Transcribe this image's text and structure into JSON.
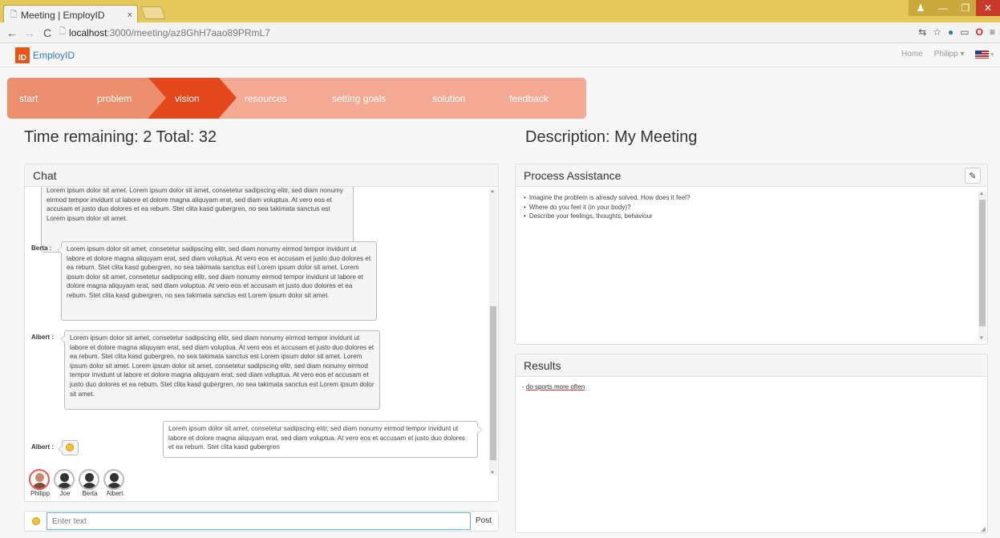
{
  "browser": {
    "tab_title": "Meeting | EmployID",
    "tab_close": "×",
    "url_host": "localhost",
    "url_path": ":3000/meeting/az8GhH7aao89PRmL7"
  },
  "app": {
    "logo_text": "ID",
    "brand": "EmployID",
    "nav_home": "Home",
    "nav_user": "Philipp ▾"
  },
  "steps": [
    {
      "label": "start",
      "state": "done"
    },
    {
      "label": "problem",
      "state": "done"
    },
    {
      "label": "vision",
      "state": "active"
    },
    {
      "label": "resources",
      "state": "todo"
    },
    {
      "label": "setting goals",
      "state": "todo"
    },
    {
      "label": "solution",
      "state": "todo"
    },
    {
      "label": "feedback",
      "state": "todo"
    }
  ],
  "colors": {
    "step_done": "#ec8f6f",
    "step_active": "#e4471c",
    "step_todo": "#f3a993",
    "steps_track": "#dba08d"
  },
  "meeting": {
    "timer": "Time remaining: 2 Total: 32",
    "description": "Description: My Meeting"
  },
  "chat": {
    "title": "Chat",
    "messages": [
      {
        "sender": "",
        "text": "Lorem ipsum dolor sit amet. Lorem ipsum dolor sit amet, consetetur sadipscing elitr, sed diam nonumy eirmod tempor invidunt ut labore et dolore magna aliquyam erat, sed diam voluptua. At vero eos et accusam et justo duo dolores et ea rebum. Stet clita kasd gubergren, no sea takimata sanctus est Lorem ipsum dolor sit amet."
      },
      {
        "sender": "Berta :",
        "text": "Lorem ipsum dolor sit amet, consetetur sadipscing elitr, sed diam nonumy eirmod tempor invidunt ut labore et dolore magna aliquyam erat, sed diam voluptua. At vero eos et accusam et justo duo dolores et ea rebum. Stet clita kasd gubergren, no sea takimata sanctus est Lorem ipsum dolor sit amet. Lorem ipsum dolor sit amet, consetetur sadipscing elitr, sed diam nonumy eirmod tempor invidunt ut labore et dolore magna aliquyam erat, sed diam voluptua. At vero eos et accusam et justo duo dolores et ea rebum. Stet clita kasd gubergren, no sea takimata sanctus est Lorem ipsum dolor sit amet."
      },
      {
        "sender": "Albert :",
        "text": "Lorem ipsum dolor sit amet, consetetur sadipscing elitr, sed diam nonumy eirmod tempor invidunt ut labore et dolore magna aliquyam erat, sed diam voluptua. At vero eos et accusam et justo duo dolores et ea rebum. Stet clita kasd gubergren, no sea takimata sanctus est Lorem ipsum dolor sit amet. Lorem ipsum dolor sit amet. Lorem ipsum dolor sit amet, consetetur sadipscing elitr, sed diam nonumy eirmod tempor invidunt ut labore et dolore magna aliquyam erat, sed diam voluptua. At vero eos et accusam et justo duo dolores et ea rebum. Stet clita kasd gubergren, no sea takimata sanctus est Lorem ipsum dolor sit amet."
      },
      {
        "sender": "",
        "text": "Lorem ipsum dolor sit amet, consetetur sadipscing elitr, sed diam nonumy eirmod tempor invidunt ut labore et dolore magna aliquyam erat, sed diam voluptua. At vero eos et accusam et justo duo dolores et ea rebum. Stet clita kasd gubergren"
      },
      {
        "sender": "Albert :",
        "text": ""
      }
    ],
    "users": [
      "Philipp",
      "Joe",
      "Berta",
      "Albert"
    ],
    "input_placeholder": "Enter text",
    "post_label": "Post"
  },
  "assist": {
    "title": "Process Assistance",
    "items": [
      "Imagine the problem is already solved. How does it feel?",
      "Where do you feel it (in your body)?",
      "Describe your feelings, thoughts, behaviour"
    ]
  },
  "results": {
    "title": "Results",
    "prefix": "- ",
    "item": "do sports more often"
  }
}
